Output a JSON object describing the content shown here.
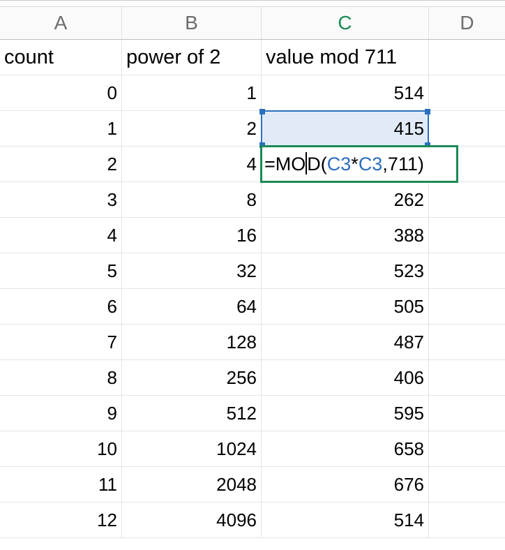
{
  "columns": {
    "A": "A",
    "B": "B",
    "C": "C",
    "D": "D"
  },
  "selected_column": "C",
  "headers": {
    "A": "count",
    "B": "power of 2",
    "C": "value mod 711"
  },
  "rows": [
    {
      "count": 0,
      "power": 1,
      "mod": 514
    },
    {
      "count": 1,
      "power": 2,
      "mod": 415
    },
    {
      "count": 2,
      "power": 4,
      "mod": null
    },
    {
      "count": 3,
      "power": 8,
      "mod": 262
    },
    {
      "count": 4,
      "power": 16,
      "mod": 388
    },
    {
      "count": 5,
      "power": 32,
      "mod": 523
    },
    {
      "count": 6,
      "power": 64,
      "mod": 505
    },
    {
      "count": 7,
      "power": 128,
      "mod": 487
    },
    {
      "count": 8,
      "power": 256,
      "mod": 406
    },
    {
      "count": 9,
      "power": 512,
      "mod": 595
    },
    {
      "count": 10,
      "power": 1024,
      "mod": 658
    },
    {
      "count": 11,
      "power": 2048,
      "mod": 676
    },
    {
      "count": 12,
      "power": 4096,
      "mod": 514
    }
  ],
  "editing": {
    "cell": "C4",
    "referenced_cell": "C3",
    "formula_display": "=MOD(C3*C3,711)",
    "tokens": {
      "eq": "=",
      "fn": "MO",
      "fn2": "D",
      "open": "(",
      "ref1": "C3",
      "star": "*",
      "ref2": "C3",
      "comma": ",",
      "num": "711",
      "close": ")"
    }
  },
  "chart_data": {
    "type": "table",
    "title": "",
    "columns": [
      "count",
      "power of 2",
      "value mod 711"
    ],
    "rows": [
      [
        0,
        1,
        514
      ],
      [
        1,
        2,
        415
      ],
      [
        2,
        4,
        "=MOD(C3*C3,711)"
      ],
      [
        3,
        8,
        262
      ],
      [
        4,
        16,
        388
      ],
      [
        5,
        32,
        523
      ],
      [
        6,
        64,
        505
      ],
      [
        7,
        128,
        487
      ],
      [
        8,
        256,
        406
      ],
      [
        9,
        512,
        595
      ],
      [
        10,
        1024,
        658
      ],
      [
        11,
        2048,
        676
      ],
      [
        12,
        4096,
        514
      ]
    ]
  }
}
